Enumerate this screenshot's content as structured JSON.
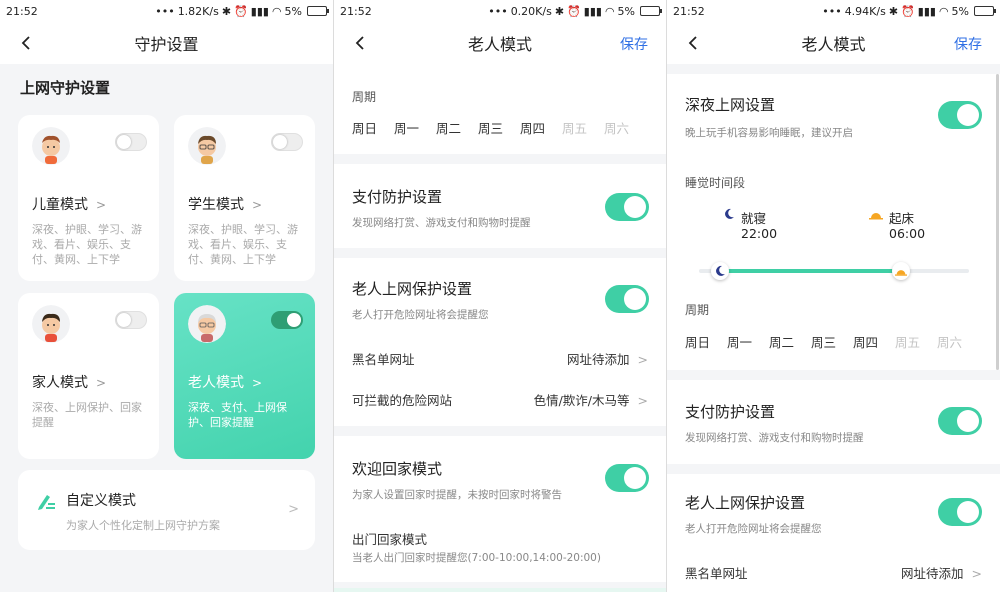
{
  "status": [
    {
      "time": "21:52",
      "speed": "1.82K/s",
      "battery": "5%"
    },
    {
      "time": "21:52",
      "speed": "0.20K/s",
      "battery": "5%"
    },
    {
      "time": "21:52",
      "speed": "4.94K/s",
      "battery": "5%"
    }
  ],
  "screen1": {
    "title": "守护设置",
    "section_title": "上网守护设置",
    "modes": [
      {
        "name": "儿童模式",
        "desc": "深夜、护眼、学习、游戏、看片、娱乐、支付、黄网、上下学",
        "enabled": false
      },
      {
        "name": "学生模式",
        "desc": "深夜、护眼、学习、游戏、看片、娱乐、支付、黄网、上下学",
        "enabled": false
      },
      {
        "name": "家人模式",
        "desc": "深夜、上网保护、回家提醒",
        "enabled": false
      },
      {
        "name": "老人模式",
        "desc": "深夜、支付、上网保护、回家提醒",
        "enabled": true
      }
    ],
    "custom": {
      "name": "自定义模式",
      "desc": "为家人个性化定制上网守护方案"
    }
  },
  "screen2": {
    "title": "老人模式",
    "save": "保存",
    "period_label": "周期",
    "weekdays": [
      "周日",
      "周一",
      "周二",
      "周三",
      "周四",
      "周五",
      "周六"
    ],
    "weekdays_active": [
      true,
      true,
      true,
      true,
      true,
      false,
      false
    ],
    "payment": {
      "title": "支付防护设置",
      "desc": "发现网络打赏、游戏支付和购物时提醒",
      "on": true
    },
    "elder_net": {
      "title": "老人上网保护设置",
      "desc": "老人打开危险网址将会提醒您",
      "on": true
    },
    "blacklist": {
      "label": "黑名单网址",
      "value": "网址待添加"
    },
    "danger": {
      "label": "可拦截的危险网站",
      "value": "色情/欺诈/木马等"
    },
    "welcome": {
      "title": "欢迎回家模式",
      "desc": "为家人设置回家时提醒，未按时回家时将警告",
      "on": true
    },
    "outdoor": {
      "title": "出门回家模式",
      "desc": "当老人出门回家时提醒您(7:00-10:00,14:00-20:00)"
    }
  },
  "screen3": {
    "title": "老人模式",
    "save": "保存",
    "night": {
      "title": "深夜上网设置",
      "desc": "晚上玩手机容易影响睡眠，建议开启",
      "on": true
    },
    "sleep_label": "睡觉时间段",
    "sleep": {
      "label": "就寝",
      "time": "22:00"
    },
    "wake": {
      "label": "起床",
      "time": "06:00"
    },
    "period_label": "周期",
    "weekdays": [
      "周日",
      "周一",
      "周二",
      "周三",
      "周四",
      "周五",
      "周六"
    ],
    "weekdays_active": [
      true,
      true,
      true,
      true,
      true,
      false,
      false
    ],
    "payment": {
      "title": "支付防护设置",
      "desc": "发现网络打赏、游戏支付和购物时提醒",
      "on": true
    },
    "elder_net": {
      "title": "老人上网保护设置",
      "desc": "老人打开危险网址将会提醒您",
      "on": true
    },
    "blacklist": {
      "label": "黑名单网址",
      "value": "网址待添加"
    }
  },
  "colors": {
    "accent": "#3fcfa5",
    "link": "#2f6fe4",
    "card_active": "#4fd8b4"
  }
}
